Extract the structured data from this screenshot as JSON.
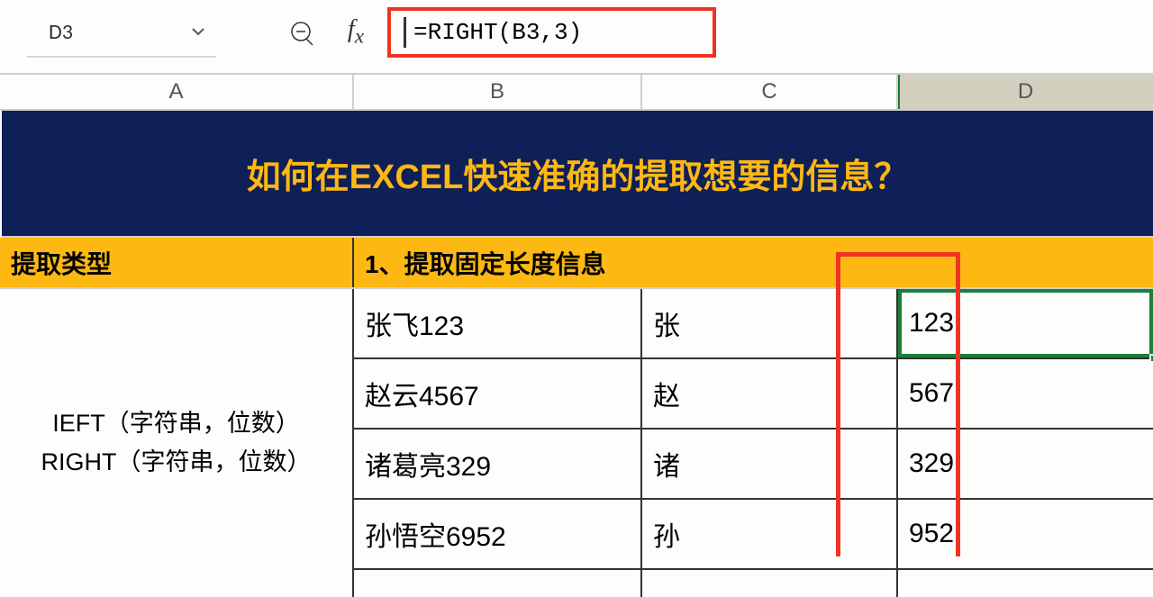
{
  "namebox": "D3",
  "formula": "=RIGHT(B3,3)",
  "columns": {
    "A": "A",
    "B": "B",
    "C": "C",
    "D": "D"
  },
  "title": "如何在EXCEL快速准确的提取想要的信息？",
  "yellow": {
    "left": "提取类型",
    "right": "1、提取固定长度信息"
  },
  "leftcol": {
    "line1": "IEFT（字符串，位数）",
    "line2": "RIGHT（字符串，位数）"
  },
  "rows": [
    {
      "b": "张飞123",
      "c": "张",
      "d": "123"
    },
    {
      "b": "赵云4567",
      "c": "赵",
      "d": "567"
    },
    {
      "b": "诸葛亮329",
      "c": "诸",
      "d": "329"
    },
    {
      "b": "孙悟空6952",
      "c": "孙",
      "d": "952"
    }
  ]
}
